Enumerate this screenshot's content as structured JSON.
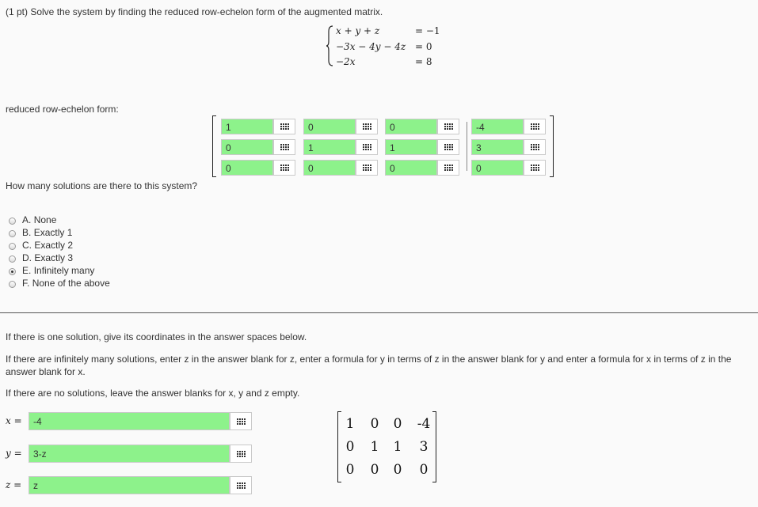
{
  "problem": {
    "header": "(1 pt) Solve the system by finding the reduced row-echelon form of the augmented matrix.",
    "equations": [
      {
        "lhs": "x + y + z",
        "rhs": "= −1"
      },
      {
        "lhs": "−3x − 4y − 4z",
        "rhs": "= 0"
      },
      {
        "lhs": "−2x",
        "rhs": "= 8"
      }
    ]
  },
  "rref": {
    "label": "reduced row-echelon form:",
    "rows": [
      [
        "1",
        "0",
        "0",
        "-4"
      ],
      [
        "0",
        "1",
        "1",
        "3"
      ],
      [
        "0",
        "0",
        "0",
        "0"
      ]
    ]
  },
  "question": {
    "text": "How many solutions are there to this system?",
    "options": [
      {
        "letter": "A.",
        "text": "None",
        "selected": false
      },
      {
        "letter": "B.",
        "text": "Exactly 1",
        "selected": false
      },
      {
        "letter": "C.",
        "text": "Exactly 2",
        "selected": false
      },
      {
        "letter": "D.",
        "text": "Exactly 3",
        "selected": false
      },
      {
        "letter": "E.",
        "text": "Infinitely many",
        "selected": true
      },
      {
        "letter": "F.",
        "text": "None of the above",
        "selected": false
      }
    ]
  },
  "instructions": {
    "p1": "If there is one solution, give its coordinates in the answer spaces below.",
    "p2": "If there are infinitely many solutions, enter z in the answer blank for z, enter a formula for y in terms of z in the answer blank for y and enter a formula for x in terms of z in the answer blank for x.",
    "p3": "If there are no solutions, leave the answer blanks for x, y and z empty."
  },
  "answers": {
    "x": {
      "label": "x =",
      "value": "-4"
    },
    "y": {
      "label": "y =",
      "value": "3-z"
    },
    "z": {
      "label": "z =",
      "value": "z"
    }
  },
  "preview_matrix": [
    [
      "1",
      "0",
      "0",
      "-4"
    ],
    [
      "0",
      "1",
      "1",
      "3"
    ],
    [
      "0",
      "0",
      "0",
      "0"
    ]
  ],
  "colors": {
    "correct_green": "#8df28b",
    "background": "#fafafa"
  },
  "icons": {
    "palette": "grid-icon"
  }
}
